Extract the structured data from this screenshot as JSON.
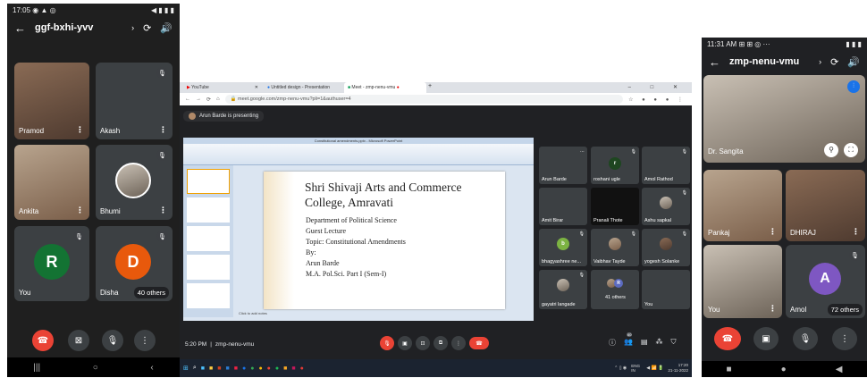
{
  "left_phone": {
    "status_time": "17:05",
    "status_icons": "◉ ▲ ◎",
    "status_right": "◀ ▮ ▮ ▮",
    "meeting_code": "ggf-bxhi-yvv",
    "tiles": [
      {
        "name": "Pramod"
      },
      {
        "name": "Akash"
      },
      {
        "name": "Ankita"
      },
      {
        "name": "Bhumi"
      },
      {
        "name": "You",
        "initial": "R"
      },
      {
        "name": "Disha",
        "initial": "D",
        "others": "40 others"
      }
    ]
  },
  "laptop": {
    "tabs": [
      "YouTube",
      "Untitled design - Presentation",
      "Meet - zmp-nenu-vmu"
    ],
    "url": "meet.google.com/zmp-nenu-vmu?pli=1&authuser=4",
    "presenting_banner": "Arun Barde is presenting",
    "ppt_title": "Constitutional amendments.pptx - Microsoft PowerPoint",
    "slide": {
      "title_line1": "Shri Shivaji Arts and Commerce",
      "title_line2": "College, Amravati",
      "lines": [
        "Department of Political Science",
        "Guest Lecture",
        "Topic: Constitutional Amendments",
        "By:",
        "Arun Barde",
        "M.A. Pol.Sci. Part I (Sem-I)"
      ],
      "notes": "Click to add notes"
    },
    "participants": [
      {
        "name": "Arun Barde"
      },
      {
        "name": "roshani ugle",
        "initial": "r"
      },
      {
        "name": "Amol Rathod"
      },
      {
        "name": "Amit Birar"
      },
      {
        "name": "Pranali Thote"
      },
      {
        "name": "Ashu sapkal"
      },
      {
        "name": "bhagyashree ne...",
        "initial": "b"
      },
      {
        "name": "Vaibhav Tayde"
      },
      {
        "name": "yogesh Solanke"
      },
      {
        "name": "gayatri langade"
      },
      {
        "name": "41 others"
      },
      {
        "name": "You"
      }
    ],
    "bottom_time": "5:20 PM",
    "bottom_code": "zmp-nenu-vmu",
    "people_count": "60",
    "taskbar_lang": "ENG IN",
    "taskbar_time": "17:20",
    "taskbar_date": "21-11-2022"
  },
  "right_phone": {
    "status_time": "11:31 AM",
    "status_icons": "⊞ ⊞ ◎ ···",
    "status_right": "▮ ▮ ▮",
    "meeting_code": "zmp-nenu-vmu",
    "tiles": [
      {
        "name": "Dr. Sangita"
      },
      {
        "name": "Pankaj"
      },
      {
        "name": "DHIRAJ"
      },
      {
        "name": "You"
      },
      {
        "name": "Amol",
        "initial": "A",
        "others": "72 others"
      }
    ]
  }
}
